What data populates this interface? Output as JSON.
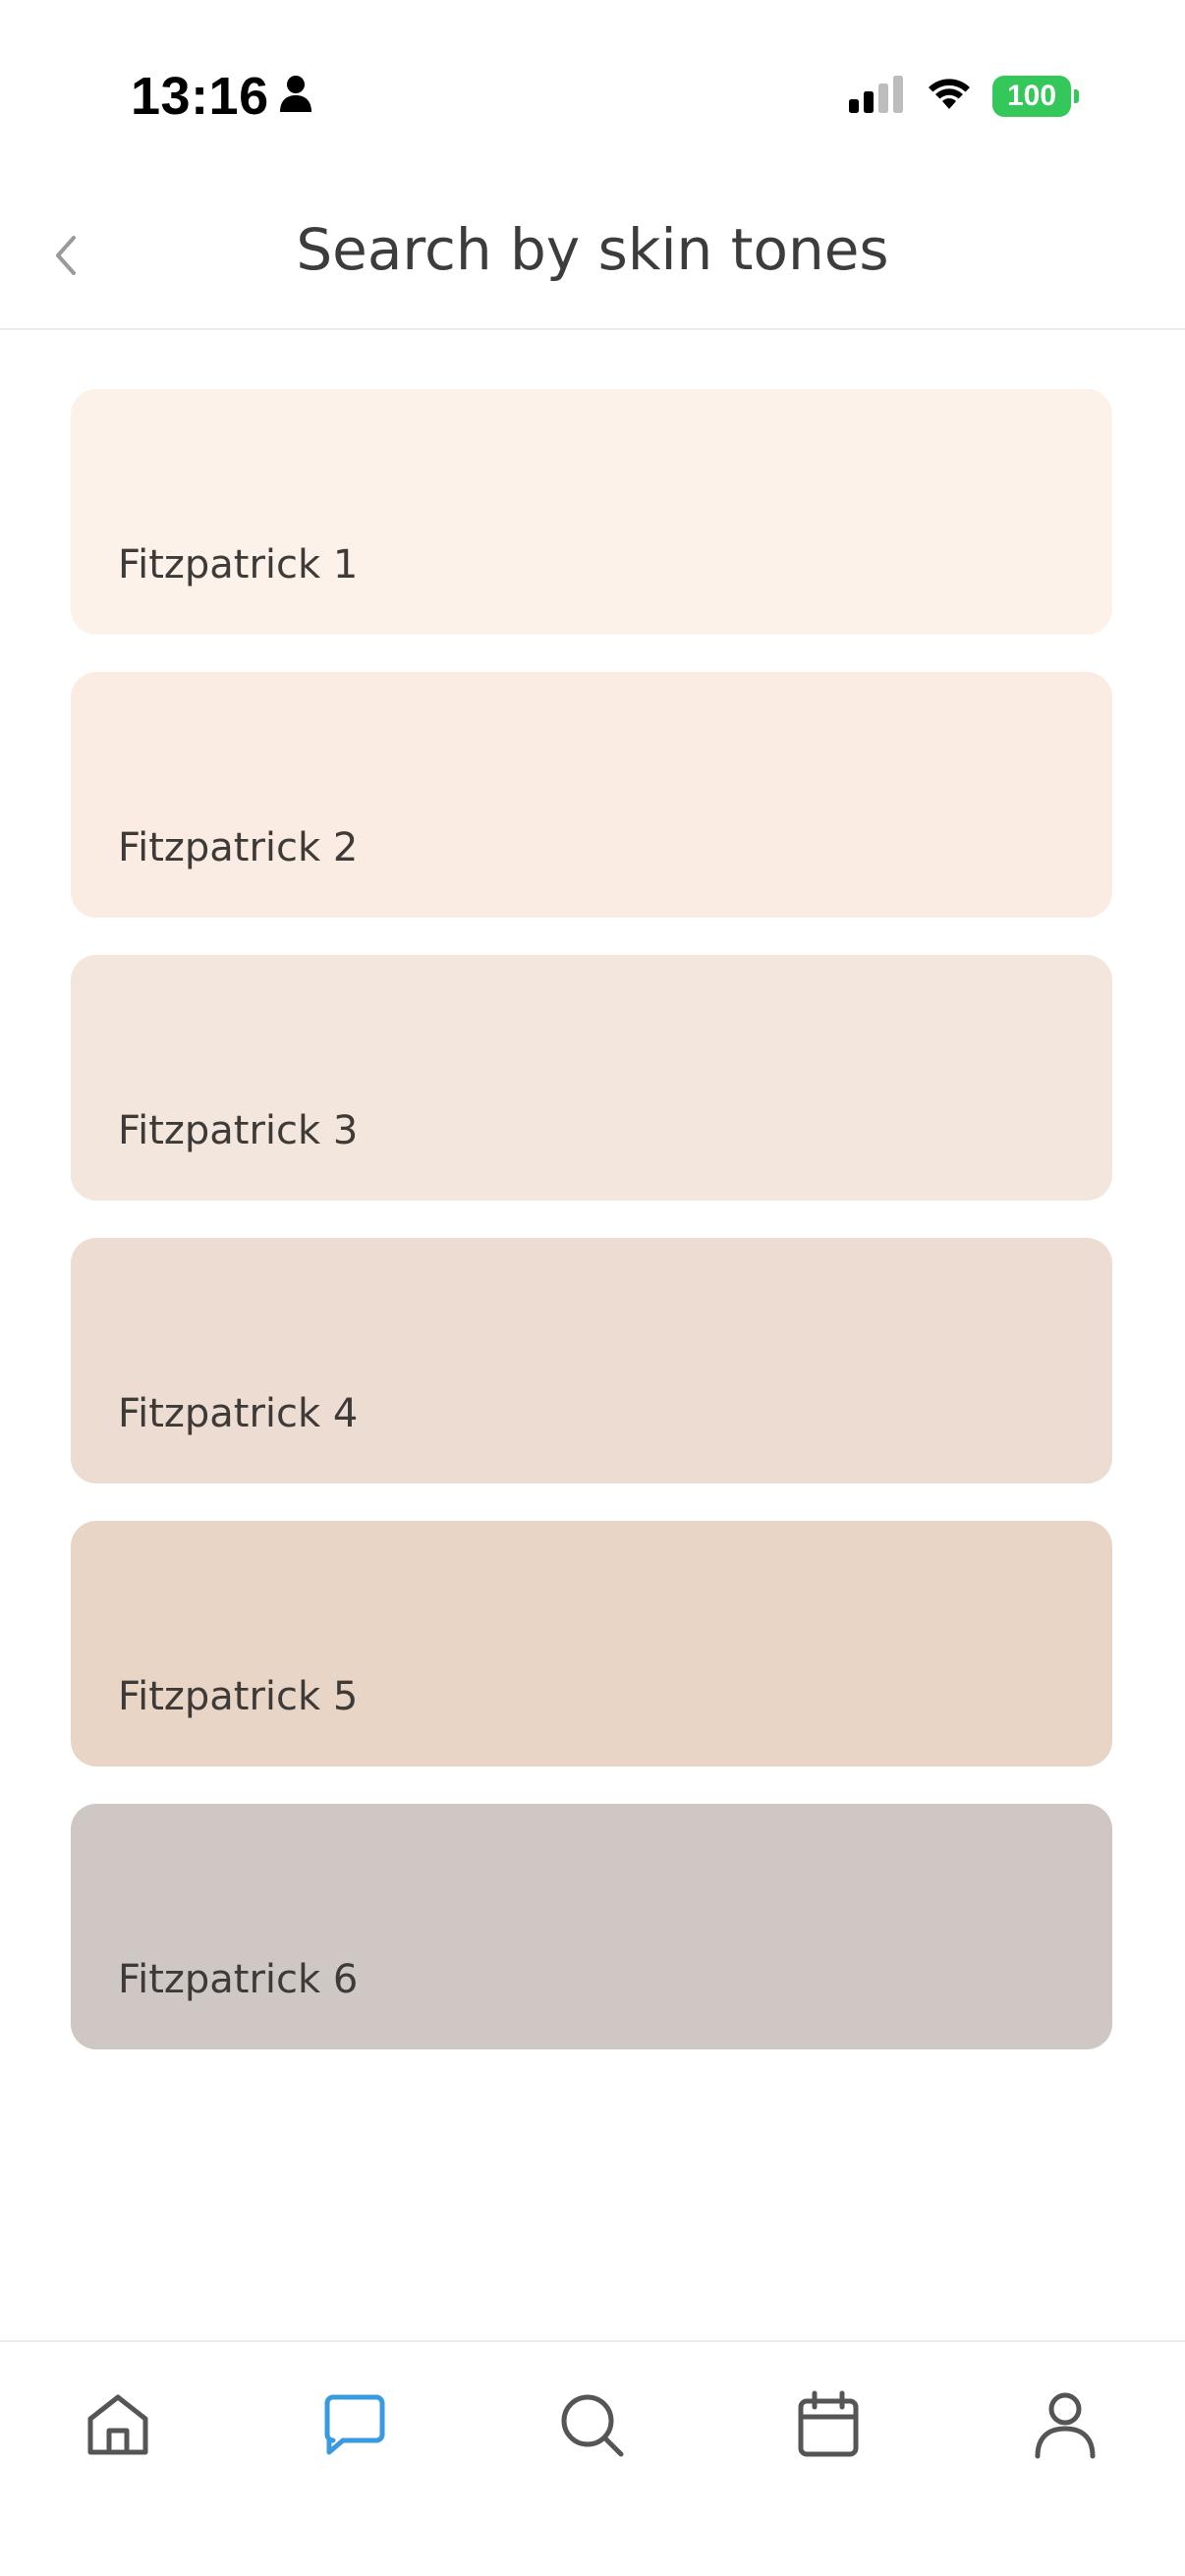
{
  "status_bar": {
    "time": "13:16",
    "battery": "100",
    "icons": [
      "person-icon",
      "signal-icon",
      "wifi-icon",
      "battery-icon"
    ]
  },
  "header": {
    "title": "Search by skin tones",
    "back_icon": "chevron-left-icon"
  },
  "tones": [
    {
      "label": "Fitzpatrick 1",
      "color": "#fcf2e9"
    },
    {
      "label": "Fitzpatrick 2",
      "color": "#faece2"
    },
    {
      "label": "Fitzpatrick 3",
      "color": "#f3e6dd"
    },
    {
      "label": "Fitzpatrick 4",
      "color": "#eddcd2"
    },
    {
      "label": "Fitzpatrick 5",
      "color": "#e8d5c6"
    },
    {
      "label": "Fitzpatrick 6",
      "color": "#cfc7c3"
    }
  ],
  "bottom_nav": {
    "items": [
      {
        "icon": "home-icon",
        "active": false
      },
      {
        "icon": "chat-icon",
        "active": true
      },
      {
        "icon": "search-icon",
        "active": false
      },
      {
        "icon": "calendar-icon",
        "active": false
      },
      {
        "icon": "profile-icon",
        "active": false
      }
    ],
    "active_color": "#3a9ae0",
    "inactive_color": "#555555"
  }
}
